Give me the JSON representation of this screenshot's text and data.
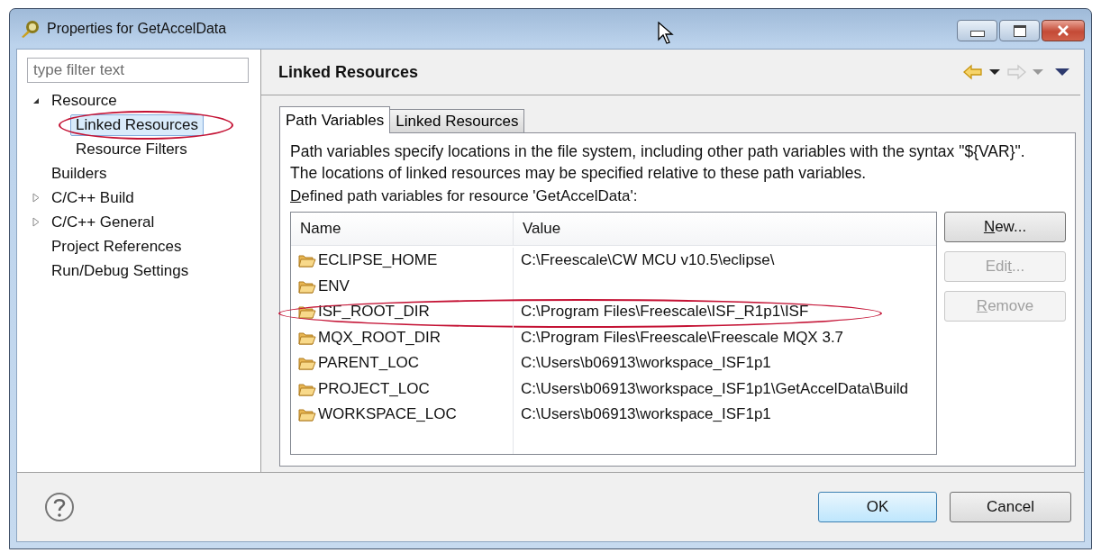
{
  "window": {
    "title": "Properties for GetAccelData"
  },
  "filter": {
    "placeholder": "type filter text"
  },
  "tree": [
    {
      "label": "Resource",
      "expanded": true,
      "selected": false,
      "circled": false,
      "children": [
        {
          "label": "Linked Resources",
          "selected": true,
          "circled": true
        },
        {
          "label": "Resource Filters",
          "selected": false,
          "circled": false
        }
      ]
    },
    {
      "label": "Builders",
      "selected": false,
      "circled": false
    },
    {
      "label": "C/C++ Build",
      "expanded": false,
      "selected": false,
      "circled": false
    },
    {
      "label": "C/C++ General",
      "expanded": false,
      "selected": false,
      "circled": false
    },
    {
      "label": "Project References",
      "selected": false,
      "circled": false
    },
    {
      "label": "Run/Debug Settings",
      "selected": false,
      "circled": false
    }
  ],
  "page": {
    "title": "Linked Resources",
    "back_enabled": true,
    "forward_enabled": false
  },
  "tabs": [
    {
      "label": "Path Variables",
      "selected": true
    },
    {
      "label": "Linked Resources",
      "selected": false
    }
  ],
  "description": [
    "Path variables specify locations in the file system, including other path variables with the syntax \"${VAR}\".",
    "The locations of linked resources may be specified relative to these path variables."
  ],
  "table_label": {
    "key": "D",
    "post": "efined path variables for resource 'GetAccelData':"
  },
  "table": {
    "columns": [
      "Name",
      "Value"
    ],
    "rows": [
      {
        "name": "ECLIPSE_HOME",
        "value": "C:\\Freescale\\CW MCU v10.5\\eclipse\\",
        "circled": false
      },
      {
        "name": "ENV",
        "circled": false
      },
      {
        "name": "ISF_ROOT_DIR",
        "value": "C:\\Program Files\\Freescale\\ISF_R1p1\\ISF",
        "circled": true
      },
      {
        "name": "MQX_ROOT_DIR",
        "value": "C:\\Program Files\\Freescale\\Freescale MQX 3.7",
        "circled": false
      },
      {
        "name": "PARENT_LOC",
        "value": "C:\\Users\\b06913\\workspace_ISF1p1",
        "circled": false
      },
      {
        "name": "PROJECT_LOC",
        "value": "C:\\Users\\b06913\\workspace_ISF1p1\\GetAccelData\\Build",
        "circled": false
      },
      {
        "name": "WORKSPACE_LOC",
        "value": "C:\\Users\\b06913\\workspace_ISF1p1",
        "circled": false
      }
    ]
  },
  "side_buttons": [
    {
      "key": "N",
      "post": "ew...",
      "disabled": false
    },
    {
      "pre": "Edi",
      "key": "t",
      "post": "...",
      "disabled": true
    },
    {
      "key": "R",
      "post": "emove",
      "disabled": true
    }
  ],
  "buttons": [
    {
      "label": "OK",
      "default": true
    },
    {
      "label": "Cancel",
      "default": false
    }
  ]
}
